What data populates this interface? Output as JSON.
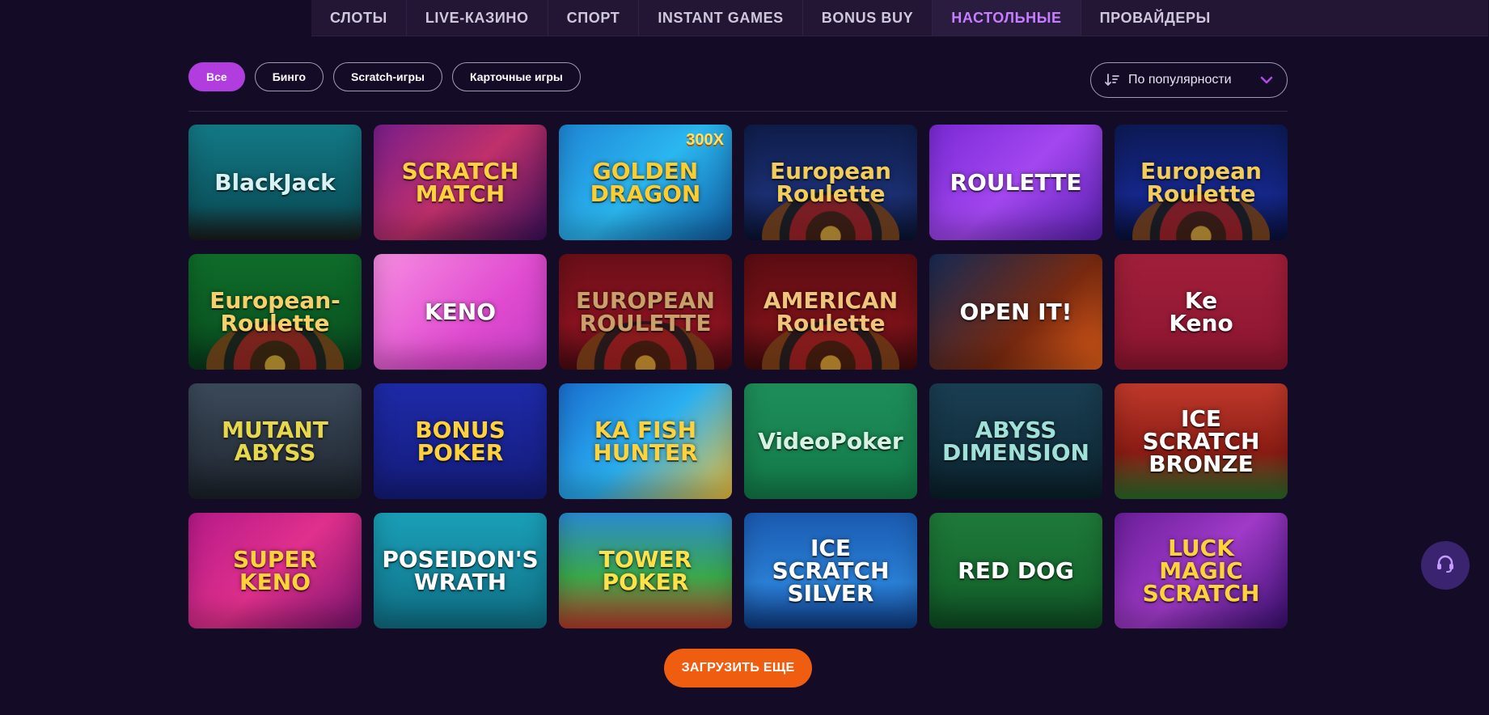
{
  "nav": {
    "items": [
      {
        "label": "СЛОТЫ",
        "active": false
      },
      {
        "label": "LIVE-КАЗИНО",
        "active": false
      },
      {
        "label": "СПОРТ",
        "active": false
      },
      {
        "label": "INSTANT GAMES",
        "active": false
      },
      {
        "label": "BONUS BUY",
        "active": false
      },
      {
        "label": "НАСТОЛЬНЫЕ",
        "active": true
      },
      {
        "label": "ПРОВАЙДЕРЫ",
        "active": false
      }
    ]
  },
  "filters": {
    "chips": [
      {
        "label": "Все",
        "active": true
      },
      {
        "label": "Бинго",
        "active": false
      },
      {
        "label": "Scratch-игры",
        "active": false
      },
      {
        "label": "Карточные игры",
        "active": false
      }
    ]
  },
  "sort": {
    "label": "По популярности",
    "icon": "sort-icon",
    "dropdown_icon": "chevron-down-icon"
  },
  "games": [
    {
      "title": "BlackJack",
      "bg": "linear-gradient(180deg,#137a86,#0b5560 70%,#1a1a1a)",
      "color": "#d8f1f2"
    },
    {
      "title": "SCRATCH\nMATCH",
      "bg": "linear-gradient(135deg,#7a1e8c,#c0306b 50%,#3a0f5a)",
      "color": "#ffd23d"
    },
    {
      "title": "GOLDEN\nDRAGON",
      "bg": "linear-gradient(135deg,#1f86d6,#2bb7f0 50%,#0f5aa0)",
      "color": "#ffcc2e",
      "badge": "300X"
    },
    {
      "title": "European Roulette",
      "bg": "linear-gradient(180deg,#0f1d4a,#1b2f72 60%,#0a1230)",
      "color": "#f3cd5c",
      "ring": true
    },
    {
      "title": "ROULETTE",
      "bg": "linear-gradient(135deg,#7a2ad6,#a347f0 50%,#5a20b0)",
      "color": "#ffffff"
    },
    {
      "title": "European Roulette",
      "bg": "linear-gradient(180deg,#0d1a55,#15278a 60%,#081038)",
      "color": "#f3cd5c",
      "ring": true
    },
    {
      "title": "European-Roulette",
      "bg": "linear-gradient(180deg,#0f6d2a,#0b5a23 60%,#07381a)",
      "color": "#f6d16b",
      "ring": true
    },
    {
      "title": "KENO",
      "bg": "linear-gradient(135deg,#f78de2,#e04bd0 60%,#c13cc3)",
      "color": "#ffffff"
    },
    {
      "title": "EUROPEAN\nROULETTE",
      "bg": "linear-gradient(180deg,#6a0f18,#8b1320 60%,#4a0a12)",
      "color": "#c9a06a",
      "ring": true
    },
    {
      "title": "AMERICAN\nRoulette",
      "bg": "linear-gradient(180deg,#5b0d12,#7a1218 60%,#3e0a0e)",
      "color": "#f0c47a",
      "ring": true
    },
    {
      "title": "OPEN IT!",
      "bg": "linear-gradient(135deg,#152a55,#7a2a10 60%,#e8611a)",
      "color": "#ffffff"
    },
    {
      "title": "Ke\nKeno",
      "bg": "linear-gradient(180deg,#a11f3a,#8c1530)",
      "color": "#ffffff"
    },
    {
      "title": "MUTANT\nABYSS",
      "bg": "linear-gradient(180deg,#3b4a5a,#2a3340 60%,#1a2028)",
      "color": "#e6d84a"
    },
    {
      "title": "BONUS\nPOKER",
      "bg": "linear-gradient(180deg,#1e2aa8,#141c7a)",
      "color": "#ffd23a"
    },
    {
      "title": "KA FISH HUNTER",
      "bg": "linear-gradient(135deg,#1a6fd1,#2bb0f0 50%,#f2c23a)",
      "color": "#ffd23a"
    },
    {
      "title": "VideoPoker",
      "bg": "linear-gradient(180deg,#1e8e5a,#137a48)",
      "color": "#d6f2e3"
    },
    {
      "title": "ABYSS\nDIMENSION",
      "bg": "linear-gradient(180deg,#1a3e52,#12303f 60%,#0a1e28)",
      "color": "#9fe0d9"
    },
    {
      "title": "ICE\nSCRATCH\nBRONZE",
      "bg": "linear-gradient(180deg,#c0392b,#8a1c14 60%,#2a6b2a)",
      "color": "#ffffff"
    },
    {
      "title": "SUPER\nKENO",
      "bg": "linear-gradient(135deg,#b81a8a,#e0308c 50%,#7a1470)",
      "color": "#ffd23a"
    },
    {
      "title": "POSEIDON'S\nWRATH",
      "bg": "linear-gradient(180deg,#1aa0b8,#0f6f85)",
      "color": "#ffffff"
    },
    {
      "title": "TOWER\nPOKER",
      "bg": "linear-gradient(180deg,#2a8ad0,#3aa84a 55%,#b83a2a)",
      "color": "#ffe24a"
    },
    {
      "title": "ICE\nSCRATCH\nSILVER",
      "bg": "linear-gradient(180deg,#1a5ab0,#2a7fd6 60%,#0f3a80)",
      "color": "#ffffff"
    },
    {
      "title": "RED DOG",
      "bg": "linear-gradient(180deg,#1f7a3a,#16692f 60%,#0f4a22)",
      "color": "#ffffff"
    },
    {
      "title": "LUCK\nMAGIC\nSCRATCH",
      "bg": "linear-gradient(135deg,#6a1f9a,#a03ac8 50%,#3a1070)",
      "color": "#ffd23a"
    }
  ],
  "load_more": {
    "label": "ЗАГРУЗИТЬ ЕЩЕ"
  },
  "support": {
    "icon": "headset-icon"
  }
}
